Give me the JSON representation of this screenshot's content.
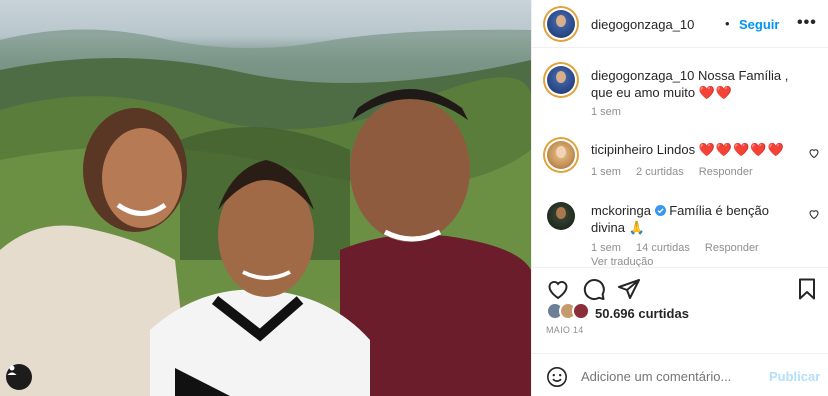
{
  "header": {
    "username": "diegogonzaga_10",
    "separator": "•",
    "follow_label": "Seguir",
    "more_icon": "more-options-icon"
  },
  "caption": {
    "username": "diegogonzaga_10",
    "text": "Nossa Família , que eu amo muito",
    "emoji": "❤️❤️",
    "time": "1 sem"
  },
  "comments": [
    {
      "username": "ticipinheiro",
      "text": "Lindos",
      "emoji": "❤️❤️❤️❤️❤️",
      "time": "1 sem",
      "likes": "2 curtidas",
      "reply": "Responder"
    },
    {
      "username": "mckoringa",
      "verified": true,
      "text": "Família é benção divina",
      "emoji": "🙏",
      "time": "1 sem",
      "likes": "14 curtidas",
      "reply": "Responder",
      "translate": "Ver tradução"
    }
  ],
  "actions": {
    "likes": "50.696 curtidas",
    "date": "MAIO 14"
  },
  "add_comment": {
    "placeholder": "Adicione um comentário...",
    "publish_label": "Publicar"
  },
  "colors": {
    "link": "#0095f6",
    "heart": "#e0243b",
    "muted": "#8e8e8e",
    "publish_disabled": "#b2dffc"
  }
}
